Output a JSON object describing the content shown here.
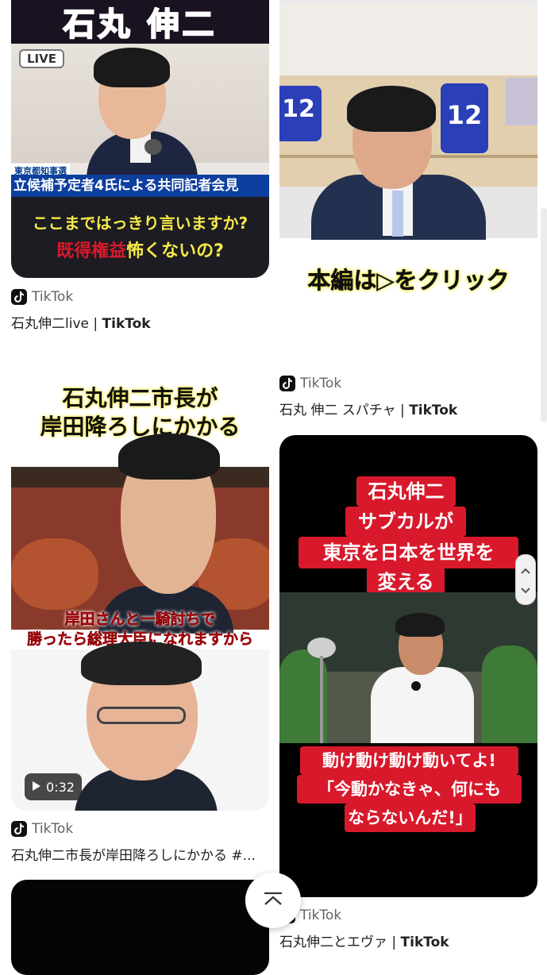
{
  "results": [
    {
      "title_text": "石丸伸二live | ",
      "source_bold": "TikTok",
      "source": "TikTok",
      "thumb_top": "石丸 伸二",
      "live_badge": "LIVE",
      "news_small": "東京都知事選",
      "news_headline": "立候補予定者4氏による共同記者会見",
      "caption_line1": "ここまではっきり言いますか?",
      "caption_line2_red": "既得権益",
      "caption_line2_rest": "怖くないの?"
    },
    {
      "title_text": "石丸 伸二 スパチャ | ",
      "source_bold": "TikTok",
      "source": "TikTok",
      "jersey_number": "12",
      "caption": "本編は▷をクリック"
    },
    {
      "title_text": "石丸伸二市長が岸田降ろしにかかる #...",
      "source": "TikTok",
      "caption_top_line1": "石丸伸二市長が",
      "caption_top_line2": "岸田降ろしにかかる",
      "caption_mid_line1": "岸田さんと一騎討ちで",
      "caption_mid_line2": "勝ったら総理大臣になれますから",
      "duration": "0:32"
    },
    {
      "title_text": "石丸伸二とエヴァ | ",
      "source_bold": "TikTok",
      "source": "TikTok",
      "caption_top": [
        "石丸伸二",
        "サブカルが",
        "東京を日本を世界を",
        "変える"
      ],
      "caption_bottom": [
        "動け動け動け動いてよ!",
        "「今動かなきゃ、何にも",
        "ならないんだ!」"
      ]
    }
  ],
  "colors": {
    "accent_red": "#d8192c",
    "caption_yellow": "#f6e94a",
    "purple": "#7a1fa6"
  }
}
